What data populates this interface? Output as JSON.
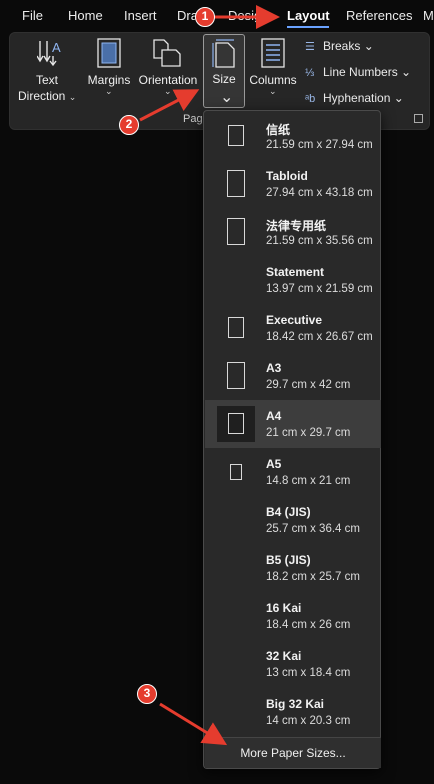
{
  "menubar": {
    "tabs": [
      {
        "label": "File"
      },
      {
        "label": "Home"
      },
      {
        "label": "Insert"
      },
      {
        "label": "Draw"
      },
      {
        "label": "Design"
      },
      {
        "label": "Layout",
        "active": true
      },
      {
        "label": "References"
      },
      {
        "label": "M"
      }
    ]
  },
  "ribbon": {
    "text_direction": {
      "line1": "Text",
      "line2": "Direction"
    },
    "margins": "Margins",
    "orientation": "Orientation",
    "size": "Size",
    "columns": "Columns",
    "breaks": "Breaks",
    "line_numbers": "Line Numbers",
    "hyphenation": "Hyphenation",
    "group_label": "Pag",
    "icons": {
      "text_direction": "text-direction-icon",
      "margins": "margins-icon",
      "orientation": "orientation-icon",
      "size": "page-size-icon",
      "columns": "columns-icon",
      "breaks": "breaks-icon",
      "line_numbers": "line-numbers-icon",
      "hyphenation": "hyphenation-icon"
    }
  },
  "size_menu": {
    "items": [
      {
        "name": "信纸",
        "dims": "21.59 cm x 27.94 cm",
        "thumb": "portrait"
      },
      {
        "name": "Tabloid",
        "dims": "27.94 cm x 43.18 cm",
        "thumb": "tall"
      },
      {
        "name": "法律专用纸",
        "dims": "21.59 cm x 35.56 cm",
        "thumb": "tall"
      },
      {
        "name": "Statement",
        "dims": "13.97 cm x 21.59 cm",
        "thumb": "none"
      },
      {
        "name": "Executive",
        "dims": "18.42 cm x 26.67 cm",
        "thumb": "portrait"
      },
      {
        "name": "A3",
        "dims": "29.7 cm x 42 cm",
        "thumb": "tall"
      },
      {
        "name": "A4",
        "dims": "21 cm x 29.7 cm",
        "thumb": "portrait",
        "selected": true
      },
      {
        "name": "A5",
        "dims": "14.8 cm x 21 cm",
        "thumb": "small"
      },
      {
        "name": "B4 (JIS)",
        "dims": "25.7 cm x 36.4 cm",
        "thumb": "none"
      },
      {
        "name": "B5 (JIS)",
        "dims": "18.2 cm x 25.7 cm",
        "thumb": "none"
      },
      {
        "name": "16 Kai",
        "dims": "18.4 cm x 26 cm",
        "thumb": "none"
      },
      {
        "name": "32 Kai",
        "dims": "13 cm x 18.4 cm",
        "thumb": "none"
      },
      {
        "name": "Big 32 Kai",
        "dims": "14 cm x 20.3 cm",
        "thumb": "none"
      }
    ],
    "more_label": "More Paper Sizes..."
  },
  "annotations": {
    "badges": [
      "1",
      "2",
      "3"
    ],
    "color": "#e53c2e"
  },
  "colors": {
    "accent": "#6aa2ff",
    "ribbon_bg": "#262626",
    "menu_bg": "#292929",
    "selected_bg": "#3d3d3d"
  }
}
